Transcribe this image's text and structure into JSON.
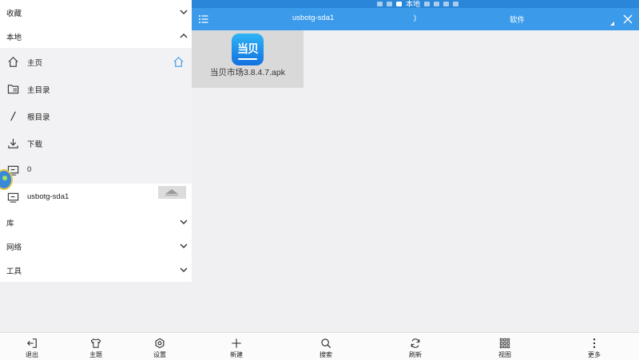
{
  "status_bar": {
    "location_label": "本地"
  },
  "drawer": {
    "sections": {
      "favorites": "收藏",
      "local": "本地",
      "library": "库",
      "network": "网络",
      "tools": "工具"
    },
    "local_items": [
      {
        "label": "主页",
        "icon": "home-icon"
      },
      {
        "label": "主目录",
        "icon": "folder-icon"
      },
      {
        "label": "根目录",
        "icon": "slash-icon"
      },
      {
        "label": "下载",
        "icon": "download-icon"
      },
      {
        "label": "0",
        "icon": "storage-icon"
      },
      {
        "label": "usbotg-sda1",
        "icon": "storage-icon"
      }
    ],
    "toolbar": {
      "exit": "退出",
      "theme": "主题",
      "settings": "设置"
    }
  },
  "header": {
    "path": "usbotg-sda1",
    "separator": ")",
    "folder": "软件"
  },
  "files": [
    {
      "name": "当贝市场3.8.4.7.apk",
      "icon_text": "当贝",
      "accent_color": "#1c8ee8"
    }
  ],
  "toolbar": {
    "new": "新建",
    "search": "搜索",
    "refresh": "刷新",
    "view": "视图",
    "more": "更多"
  },
  "colors": {
    "header": "#3b9bea",
    "status_bar": "#2a86d8",
    "highlight_icon": "#3b9bea"
  }
}
